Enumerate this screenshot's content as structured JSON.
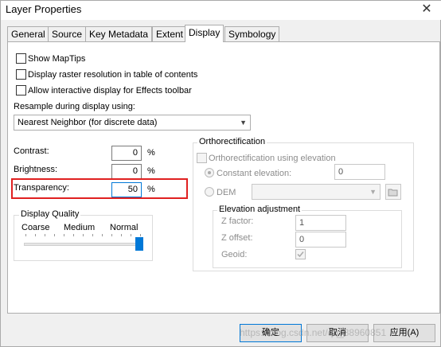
{
  "window": {
    "title": "Layer Properties",
    "close_glyph": "✕"
  },
  "tabs": [
    {
      "label": "General"
    },
    {
      "label": "Source"
    },
    {
      "label": "Key Metadata"
    },
    {
      "label": "Extent"
    },
    {
      "label": "Display"
    },
    {
      "label": "Symbology"
    }
  ],
  "active_tab": "Display",
  "checkboxes": {
    "show_maptips": "Show MapTips",
    "raster_resolution": "Display raster resolution in table of contents",
    "effects_toolbar": "Allow interactive display for Effects toolbar"
  },
  "resample": {
    "label": "Resample during display using:",
    "value": "Nearest Neighbor (for discrete data)"
  },
  "contrast": {
    "label": "Contrast:",
    "value": "0",
    "unit": "%"
  },
  "brightness": {
    "label": "Brightness:",
    "value": "0",
    "unit": "%"
  },
  "transparency": {
    "label": "Transparency:",
    "value": "50",
    "unit": "%"
  },
  "display_quality": {
    "title": "Display Quality",
    "coarse": "Coarse",
    "medium": "Medium",
    "normal": "Normal",
    "level": 1.0
  },
  "ortho": {
    "title": "Orthorectification",
    "use_elevation_label": "Orthorectification using elevation",
    "constant_label": "Constant elevation:",
    "constant_value": "0",
    "dem_label": "DEM",
    "elevation_adjustment": "Elevation adjustment",
    "z_factor_label": "Z factor:",
    "z_factor_value": "1",
    "z_offset_label": "Z offset:",
    "z_offset_value": "0",
    "geoid_label": "Geoid:"
  },
  "buttons": {
    "ok": "确定",
    "cancel": "取消",
    "apply": "应用(A)"
  },
  "watermark": "https://blog.csdn.net/qq_38960851",
  "colors": {
    "accent": "#0078d7",
    "highlight_box": "#e02020"
  }
}
